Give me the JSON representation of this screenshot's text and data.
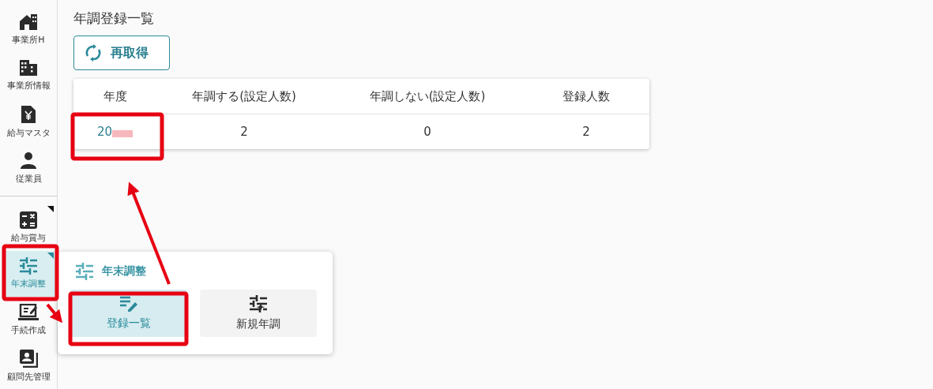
{
  "sidebar": {
    "items": [
      {
        "label": "事業所H",
        "kind": "home",
        "selected": false,
        "has_submenu": false
      },
      {
        "label": "事業所情報",
        "kind": "building",
        "selected": false,
        "has_submenu": false
      },
      {
        "label": "給与マスタ",
        "kind": "yen-file",
        "selected": false,
        "has_submenu": false
      },
      {
        "label": "従業員",
        "kind": "person",
        "selected": false,
        "has_submenu": false
      },
      {
        "label": "給与賞与",
        "kind": "calculator",
        "selected": false,
        "has_submenu": true
      },
      {
        "label": "年末調整",
        "kind": "tune",
        "selected": true,
        "has_submenu": true
      },
      {
        "label": "手続作成",
        "kind": "edit-monitor",
        "selected": false,
        "has_submenu": false
      },
      {
        "label": "顧問先管理",
        "kind": "contact",
        "selected": false,
        "has_submenu": false
      }
    ]
  },
  "page": {
    "title": "年調登録一覧",
    "reload_button": "再取得"
  },
  "table": {
    "columns": [
      "年度",
      "年調する(設定人数)",
      "年調しない(設定人数)",
      "登録人数"
    ],
    "rows": [
      [
        "20",
        "2",
        "0",
        "2"
      ]
    ]
  },
  "flyout": {
    "title": "年末調整",
    "items": [
      {
        "label": "登録一覧",
        "kind": "list-edit",
        "selected": true
      },
      {
        "label": "新規年調",
        "kind": "tune-new",
        "selected": false
      }
    ]
  }
}
